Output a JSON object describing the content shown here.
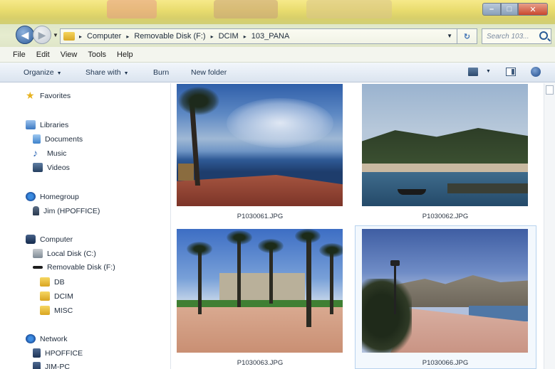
{
  "window": {
    "controls": {
      "minimize": "–",
      "maximize": "□",
      "close": "✕"
    }
  },
  "navigation": {
    "back_glyph": "◀",
    "forward_glyph": "▶",
    "recent_glyph": "▼",
    "breadcrumbs": [
      "Computer",
      "Removable Disk (F:)",
      "DCIM",
      "103_PANA"
    ],
    "separator": "▸",
    "address_dropdown": "▼",
    "refresh_glyph": "↻",
    "search_placeholder": "Search 103..."
  },
  "menubar": [
    "File",
    "Edit",
    "View",
    "Tools",
    "Help"
  ],
  "commandbar": {
    "organize": "Organize",
    "share_with": "Share with",
    "burn": "Burn",
    "new_folder": "New folder",
    "dropdown_glyph": "▼"
  },
  "navpane": {
    "favorites": "Favorites",
    "libraries": "Libraries",
    "documents": "Documents",
    "music": "Music",
    "videos": "Videos",
    "homegroup": "Homegroup",
    "homegroup_user": "Jim (HPOFFICE)",
    "computer": "Computer",
    "local_disk": "Local Disk (C:)",
    "removable_disk": "Removable Disk (F:)",
    "folder_db": "DB",
    "folder_dcim": "DCIM",
    "folder_misc": "MISC",
    "network": "Network",
    "net_pc1": "HPOFFICE",
    "net_pc2": "JIM-PC"
  },
  "files": [
    {
      "name": "P1030061.JPG",
      "selected": false
    },
    {
      "name": "P1030062.JPG",
      "selected": false
    },
    {
      "name": "P1030063.JPG",
      "selected": false
    },
    {
      "name": "P1030066.JPG",
      "selected": true
    }
  ],
  "icons": {
    "star": "★",
    "music": "♪"
  }
}
